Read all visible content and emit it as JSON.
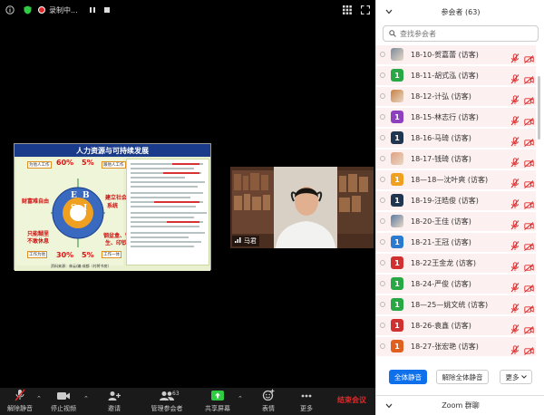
{
  "topbar": {
    "recording_label": "录制中...",
    "colors": {
      "shield": "#2ecc40",
      "lock": "#2ecc40",
      "rec": "#e02828"
    }
  },
  "shared_screen": {
    "title": "人力资源与可持续发展",
    "pct_tl": "60%",
    "pct_tr": "5%",
    "pct_bl": "30%",
    "pct_br": "5%",
    "tag_tl": "为他人工作",
    "tag_tr": "跟他人工作",
    "tag_bl": "工作为他",
    "tag_br": "工作一体",
    "red_left_1": "财富难自由",
    "red_left_2": "只能糊里",
    "red_left_3": "不敢休息",
    "red_right_1": "建立社会",
    "red_right_2": "系统",
    "red_right_3": "钢盆盒、钱",
    "red_right_4": "生、印钞",
    "wheel_e": "E",
    "wheel_b": "B",
    "wheel_s": "S",
    "wheel_i": "I",
    "footer": "资料来源：林云/编·成都（村将书房）"
  },
  "video": {
    "name": "马君"
  },
  "toolbar": {
    "mute": "解除静音",
    "video": "停止视频",
    "invite": "邀请",
    "manage": "管理参会者",
    "manage_count": "63",
    "share": "共享屏幕",
    "react": "表情",
    "more": "更多",
    "end": "结束会议"
  },
  "panel": {
    "title": "参会者 (63)",
    "search_placeholder": "查找参会者",
    "participants": [
      {
        "name": "18-10-贺嘉蕾 (访客)",
        "avatar": "",
        "avatar_color": "#7a8a9a",
        "photo": true
      },
      {
        "name": "18-11-胡式泓 (访客)",
        "avatar": "1",
        "avatar_color": "#27a844"
      },
      {
        "name": "18-12-计弘 (访客)",
        "avatar": "",
        "avatar_color": "#c88040",
        "photo": true
      },
      {
        "name": "18-15-林志行 (访客)",
        "avatar": "1",
        "avatar_color": "#8e3fc0"
      },
      {
        "name": "18-16-马琦 (访客)",
        "avatar": "1",
        "avatar_color": "#1f3550"
      },
      {
        "name": "18-17-钱琦 (访客)",
        "avatar": "",
        "avatar_color": "#e0a080",
        "photo": true
      },
      {
        "name": "18—18—沈叶爽 (访客)",
        "avatar": "1",
        "avatar_color": "#f0a020"
      },
      {
        "name": "18-19-汪皓俊 (访客)",
        "avatar": "1",
        "avatar_color": "#1f3550"
      },
      {
        "name": "18-20-王佳 (访客)",
        "avatar": "",
        "avatar_color": "#5a7aa0",
        "photo": true
      },
      {
        "name": "18-21-王冠 (访客)",
        "avatar": "1",
        "avatar_color": "#2a7ad0"
      },
      {
        "name": "18-22王金龙 (访客)",
        "avatar": "1",
        "avatar_color": "#d03030"
      },
      {
        "name": "18-24-严俊 (访客)",
        "avatar": "1",
        "avatar_color": "#27a844"
      },
      {
        "name": "18—25—姚文统 (访客)",
        "avatar": "1",
        "avatar_color": "#27a844"
      },
      {
        "name": "18-26-袁鑫 (访客)",
        "avatar": "1",
        "avatar_color": "#d03030"
      },
      {
        "name": "18-27-张宏艳 (访客)",
        "avatar": "1",
        "avatar_color": "#e06020"
      }
    ],
    "mute_all": "全体静音",
    "unmute_all": "解除全体静音",
    "more": "更多",
    "chat_title": "Zoom 群聊",
    "accent": "#0e71eb"
  }
}
